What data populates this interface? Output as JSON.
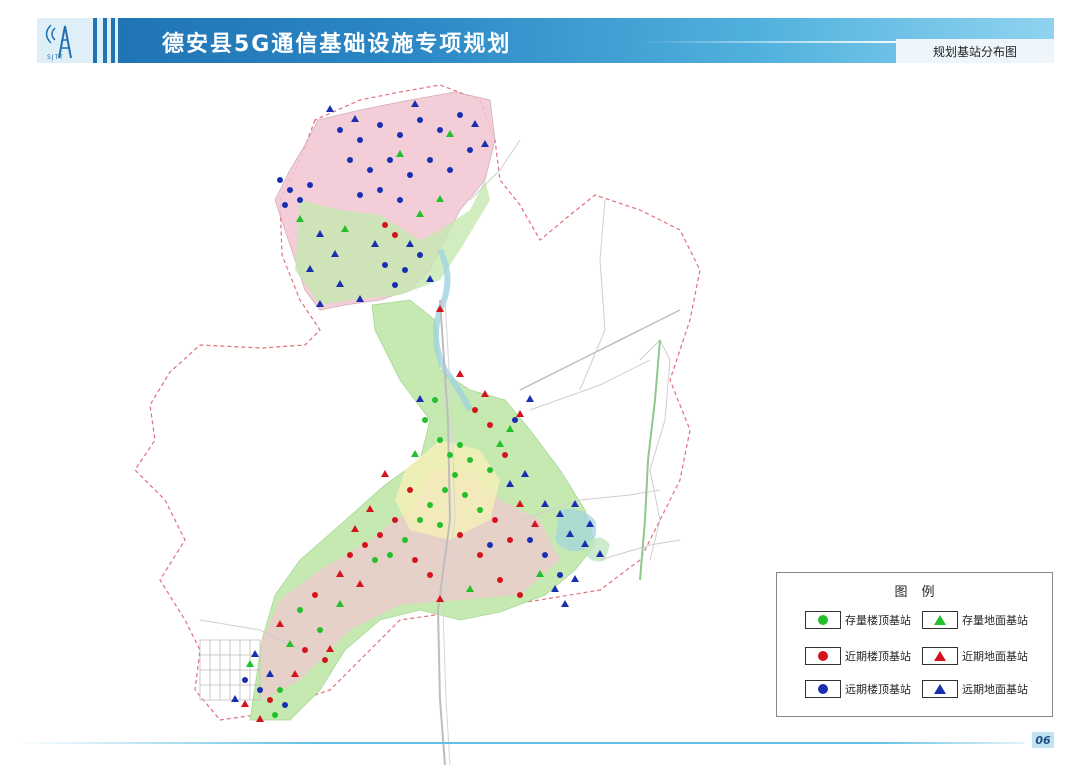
{
  "header": {
    "title": "德安县5G通信基础设施专项规划",
    "subtitle": "规划基站分布图",
    "logo_text": "SJTT"
  },
  "footer": {
    "page_number": "06"
  },
  "legend": {
    "title": "图例",
    "items": [
      {
        "label": "存量楼顶基站",
        "shape": "circle",
        "color": "#22c02a"
      },
      {
        "label": "存量地面基站",
        "shape": "triangle",
        "color": "#22c02a"
      },
      {
        "label": "近期楼顶基站",
        "shape": "circle",
        "color": "#d4141c"
      },
      {
        "label": "近期地面基站",
        "shape": "triangle",
        "color": "#d4141c"
      },
      {
        "label": "远期楼顶基站",
        "shape": "circle",
        "color": "#1a2fb0"
      },
      {
        "label": "远期地面基站",
        "shape": "triangle",
        "color": "#1a2fb0"
      }
    ]
  },
  "colors": {
    "header_blue": "#1d6fb0",
    "boundary": "#e0707a",
    "landuse_green": "#c5e9b0",
    "landuse_pink": "#f2c6d2",
    "water": "#9fd3df"
  }
}
